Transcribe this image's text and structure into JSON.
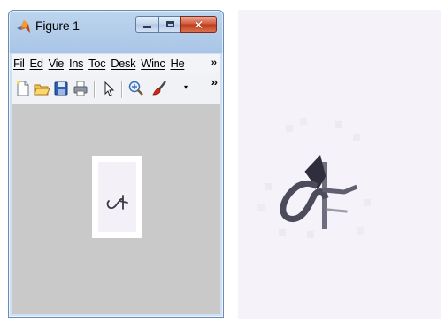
{
  "window": {
    "title": "Figure 1",
    "icon": "matlab-logo-icon",
    "controls": {
      "minimize": "minimize-icon",
      "maximize": "maximize-icon",
      "close": "close-icon",
      "close_color": "#c8401f"
    }
  },
  "menu": {
    "items": [
      {
        "label": "Fil"
      },
      {
        "label": "Ed"
      },
      {
        "label": "Vie"
      },
      {
        "label": "Ins"
      },
      {
        "label": "Toc"
      },
      {
        "label": "Desk"
      },
      {
        "label": "Winc"
      },
      {
        "label": "He"
      }
    ],
    "overflow_glyph": "»"
  },
  "toolbar": {
    "tools": [
      {
        "name": "new-figure-icon"
      },
      {
        "name": "open-file-icon"
      },
      {
        "name": "save-figure-icon"
      },
      {
        "name": "print-figure-icon"
      },
      {
        "name": "edit-plot-arrow-icon"
      },
      {
        "name": "zoom-in-icon"
      },
      {
        "name": "brush-icon"
      }
    ],
    "dropdown_glyph": "▾",
    "overflow_glyph": "»"
  },
  "colors": {
    "figure_background": "#c9c9c9",
    "image_background": "#f3f0f8",
    "glyph_ink": "#3a3a48",
    "zoom_background": "#f6f2fa"
  },
  "figure_image": {
    "glyph": "handwritten-character-icon"
  }
}
